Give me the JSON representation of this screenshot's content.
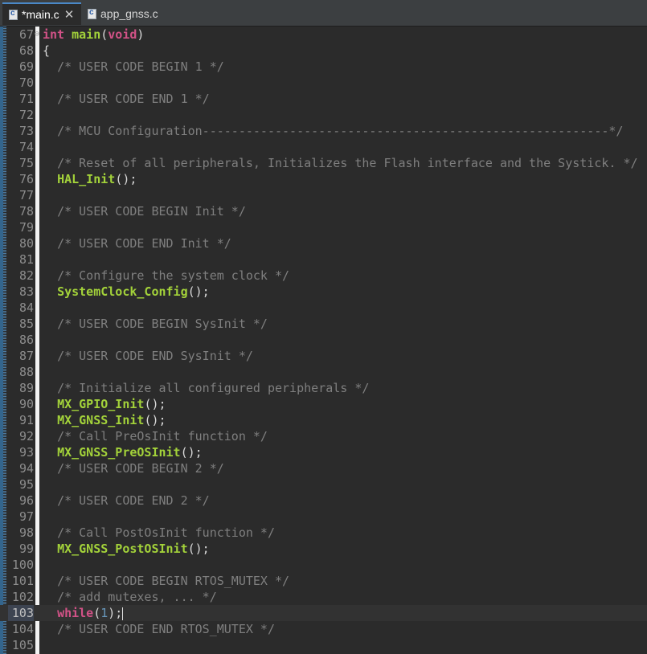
{
  "tabs": [
    {
      "label": "*main.c",
      "active": true,
      "icon": "c-file-icon"
    },
    {
      "label": "app_gnss.c",
      "active": false,
      "icon": "c-file-icon"
    }
  ],
  "editor": {
    "current_line": "103",
    "lines": [
      {
        "n": "67",
        "t": "int main(void)"
      },
      {
        "n": "68",
        "t": "{"
      },
      {
        "n": "69",
        "t": "  /* USER CODE BEGIN 1 */"
      },
      {
        "n": "70",
        "t": ""
      },
      {
        "n": "71",
        "t": "  /* USER CODE END 1 */"
      },
      {
        "n": "72",
        "t": ""
      },
      {
        "n": "73",
        "t": "  /* MCU Configuration--------------------------------------------------------*/"
      },
      {
        "n": "74",
        "t": ""
      },
      {
        "n": "75",
        "t": "  /* Reset of all peripherals, Initializes the Flash interface and the Systick. */"
      },
      {
        "n": "76",
        "t": "  HAL_Init();"
      },
      {
        "n": "77",
        "t": ""
      },
      {
        "n": "78",
        "t": "  /* USER CODE BEGIN Init */"
      },
      {
        "n": "79",
        "t": ""
      },
      {
        "n": "80",
        "t": "  /* USER CODE END Init */"
      },
      {
        "n": "81",
        "t": ""
      },
      {
        "n": "82",
        "t": "  /* Configure the system clock */"
      },
      {
        "n": "83",
        "t": "  SystemClock_Config();"
      },
      {
        "n": "84",
        "t": ""
      },
      {
        "n": "85",
        "t": "  /* USER CODE BEGIN SysInit */"
      },
      {
        "n": "86",
        "t": ""
      },
      {
        "n": "87",
        "t": "  /* USER CODE END SysInit */"
      },
      {
        "n": "88",
        "t": ""
      },
      {
        "n": "89",
        "t": "  /* Initialize all configured peripherals */"
      },
      {
        "n": "90",
        "t": "  MX_GPIO_Init();"
      },
      {
        "n": "91",
        "t": "  MX_GNSS_Init();"
      },
      {
        "n": "92",
        "t": "  /* Call PreOsInit function */"
      },
      {
        "n": "93",
        "t": "  MX_GNSS_PreOSInit();"
      },
      {
        "n": "94",
        "t": "  /* USER CODE BEGIN 2 */"
      },
      {
        "n": "95",
        "t": ""
      },
      {
        "n": "96",
        "t": "  /* USER CODE END 2 */"
      },
      {
        "n": "97",
        "t": ""
      },
      {
        "n": "98",
        "t": "  /* Call PostOsInit function */"
      },
      {
        "n": "99",
        "t": "  MX_GNSS_PostOSInit();"
      },
      {
        "n": "100",
        "t": ""
      },
      {
        "n": "101",
        "t": "  /* USER CODE BEGIN RTOS_MUTEX */"
      },
      {
        "n": "102",
        "t": "  /* add mutexes, ... */"
      },
      {
        "n": "103",
        "t": "  while(1);"
      },
      {
        "n": "104",
        "t": "  /* USER CODE END RTOS_MUTEX */"
      },
      {
        "n": "105",
        "t": ""
      }
    ]
  },
  "colors": {
    "background": "#2b2b2b",
    "keyword": "#d25287",
    "function": "#a3d23a",
    "comment": "#7f7f7f",
    "number": "#6897bb"
  }
}
